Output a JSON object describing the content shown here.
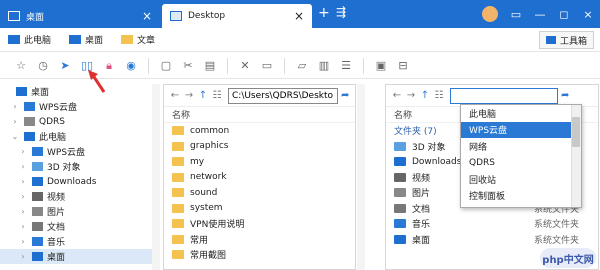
{
  "tabs": [
    {
      "label": "桌面",
      "close": "×"
    },
    {
      "label": "Desktop",
      "close": "×"
    }
  ],
  "tab_add": "+",
  "tab_new": "⇶",
  "window_controls": [
    "▭",
    "—",
    "◻",
    "×"
  ],
  "bookmarks": [
    {
      "label": "此电脑"
    },
    {
      "label": "桌面"
    },
    {
      "label": "文章"
    }
  ],
  "toolbox_label": "工具箱",
  "toolbar_icons": [
    "star-icon",
    "clock-icon",
    "location-icon",
    "split-view-icon",
    "lock-icon",
    "eye-icon",
    "copy-icon",
    "cut-icon",
    "paste-icon",
    "delete-icon",
    "rename-icon",
    "new-folder-icon",
    "bin-icon",
    "properties-icon",
    "info-icon",
    "share-icon"
  ],
  "sidebar": [
    {
      "label": "桌面",
      "exp": "",
      "indent": 0,
      "icon": "blue"
    },
    {
      "label": "WPS云盘",
      "exp": "›",
      "indent": 1,
      "icon": "cloud"
    },
    {
      "label": "QDRS",
      "exp": "›",
      "indent": 1,
      "icon": "user"
    },
    {
      "label": "此电脑",
      "exp": "⌄",
      "indent": 1,
      "icon": "pc"
    },
    {
      "label": "WPS云盘",
      "exp": "›",
      "indent": 2,
      "icon": "cloud"
    },
    {
      "label": "3D 对象",
      "exp": "›",
      "indent": 2,
      "icon": "3d"
    },
    {
      "label": "Downloads",
      "exp": "›",
      "indent": 2,
      "icon": "download"
    },
    {
      "label": "视频",
      "exp": "›",
      "indent": 2,
      "icon": "video"
    },
    {
      "label": "图片",
      "exp": "›",
      "indent": 2,
      "icon": "image"
    },
    {
      "label": "文档",
      "exp": "›",
      "indent": 2,
      "icon": "doc"
    },
    {
      "label": "音乐",
      "exp": "›",
      "indent": 2,
      "icon": "music"
    },
    {
      "label": "桌面",
      "exp": "›",
      "indent": 2,
      "icon": "blue"
    }
  ],
  "pane1": {
    "path": "C:\\Users\\QDRS\\Deskto",
    "column": "名称",
    "items": [
      "common",
      "graphics",
      "my",
      "network",
      "sound",
      "system",
      "VPN使用说明",
      "常用",
      "常用截图"
    ]
  },
  "pane2": {
    "path": "",
    "column": "名称",
    "group": "文件夹 (7)",
    "items": [
      {
        "name": "3D 对象",
        "type": ""
      },
      {
        "name": "Downloads",
        "type": ""
      },
      {
        "name": "视频",
        "type": ""
      },
      {
        "name": "图片",
        "type": ""
      },
      {
        "name": "文档",
        "type": "系统文件夹"
      },
      {
        "name": "音乐",
        "type": "系统文件夹"
      },
      {
        "name": "桌面",
        "type": "系统文件夹"
      }
    ]
  },
  "dropdown": {
    "options": [
      "此电脑",
      "WPS云盘",
      "网络",
      "QDRS",
      "回收站",
      "控制面板"
    ],
    "selected_index": 1
  },
  "watermark": "php中文网",
  "colors": {
    "accent": "#1e6fd0",
    "selection": "#2a7ad5",
    "folder": "#f3c24f",
    "arrow": "#e03030"
  }
}
